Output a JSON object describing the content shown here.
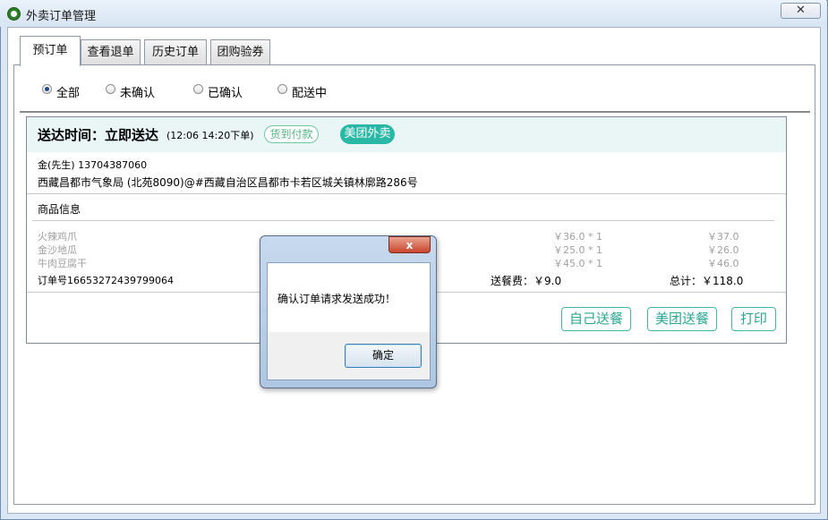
{
  "window": {
    "title": "外卖订单管理",
    "close_glyph": "✕"
  },
  "tabs": [
    {
      "label": "预订单",
      "active": true
    },
    {
      "label": "查看退单"
    },
    {
      "label": "历史订单"
    },
    {
      "label": "团购验券"
    }
  ],
  "filters": [
    {
      "label": "全部",
      "selected": true
    },
    {
      "label": "未确认"
    },
    {
      "label": "已确认"
    },
    {
      "label": "配送中"
    }
  ],
  "order": {
    "deliver_text": "送达时间：立即送达",
    "time_text": "(12:06  14:20下单)",
    "pay_badge": "货到付款",
    "platform_badge": "美团外卖",
    "customer": "金(先生)  13704387060",
    "address": "西藏昌都市气象局 (北苑8090)@#西藏自治区昌都市卡若区城关镇林廓路286号",
    "goods_title": "商品信息",
    "items": [
      {
        "name": "火辣鸡爪",
        "price": "￥36.0 * 1",
        "total": "￥37.0"
      },
      {
        "name": "金沙地瓜",
        "price": "￥25.0 * 1",
        "total": "￥26.0"
      },
      {
        "name": "牛肉豆腐干",
        "price": "￥45.0 * 1",
        "total": "￥46.0"
      }
    ],
    "order_no": "订单号16653272439799064",
    "delivery_fee": "送餐费：￥9.0",
    "total": "总计：￥118.0",
    "buttons": {
      "self_delivery": "自己送餐",
      "meituan_delivery": "美团送餐",
      "print": "打印"
    }
  },
  "dialog": {
    "message": "确认订单请求发送成功！",
    "ok_label": "确定",
    "close_glyph": "x"
  },
  "colors": {
    "accent": "#2ab8a6",
    "pay_badge": "#4fb383",
    "header_bg": "#eaf6f6"
  }
}
